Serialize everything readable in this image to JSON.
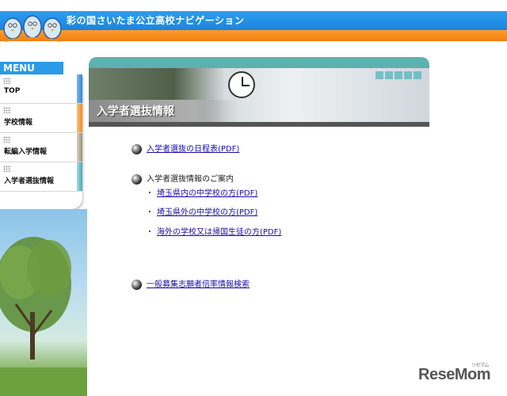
{
  "header": {
    "site_title": "彩の国さいたま公立高校ナビゲーション"
  },
  "sidebar": {
    "menu_title": "MENU",
    "items": [
      {
        "label": "TOP",
        "accent": "#2f86d6"
      },
      {
        "label": "学校情報",
        "accent": "#f08a1c"
      },
      {
        "label": "転編入学情報",
        "accent": "#9c8f7a"
      },
      {
        "label": "入学者選抜情報",
        "accent": "#46a7b0"
      }
    ]
  },
  "main": {
    "section_title": "入学者選抜情報",
    "links": {
      "schedule": "入学者選抜の日程表(PDF)",
      "guide_heading": "入学者選抜情報のご案内",
      "in_pref": "埼玉県内の中学校の方(PDF)",
      "out_pref": "埼玉県外の中学校の方(PDF)",
      "overseas": "海外の学校又は帰国生徒の方(PDF)",
      "ratio_search": "一般募集志願者倍率情報検索"
    }
  },
  "watermark": {
    "brand": "ReseMom",
    "kana": "リセマム"
  }
}
